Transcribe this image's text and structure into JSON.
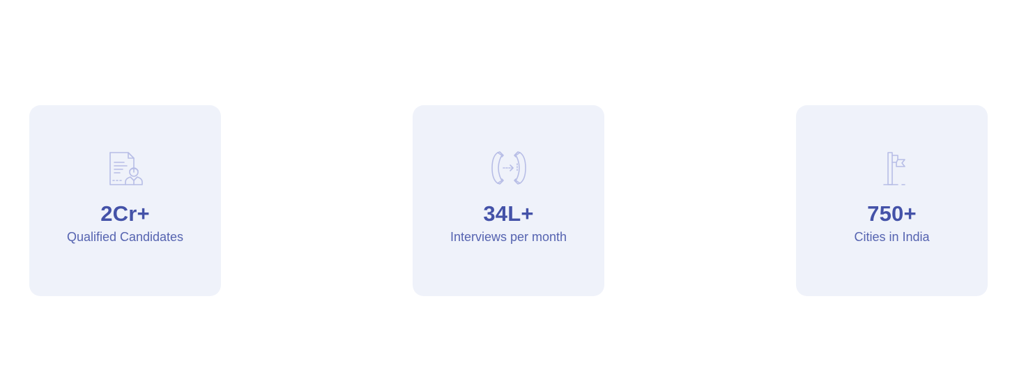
{
  "stats": [
    {
      "value": "2Cr+",
      "label": "Qualified Candidates",
      "icon": "resume-candidate-icon"
    },
    {
      "value": "34L+",
      "label": "Interviews per month",
      "icon": "phone-call-icon"
    },
    {
      "value": "750+",
      "label": "Cities in India",
      "icon": "flag-icon"
    }
  ],
  "colors": {
    "card_background": "#eff2fa",
    "value_text": "#4452a8",
    "label_text": "#5563b0",
    "icon_stroke": "#b7bde6"
  }
}
